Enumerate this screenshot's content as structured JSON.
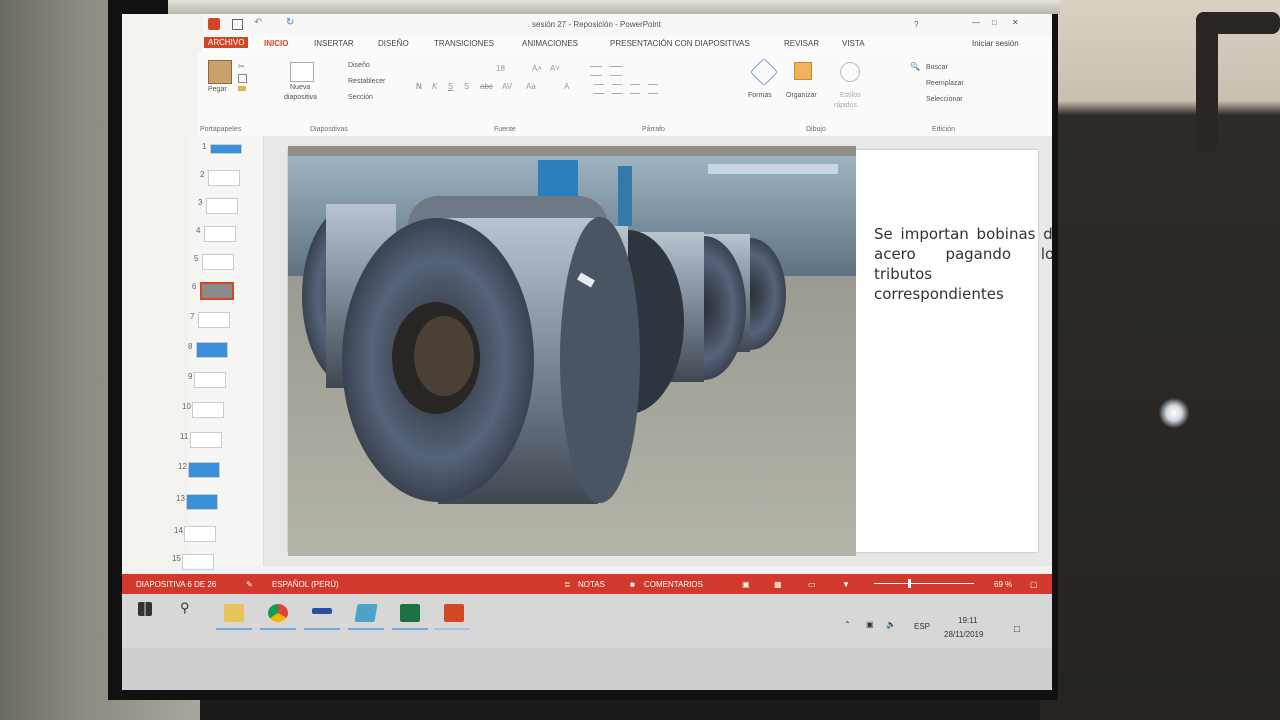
{
  "window": {
    "title": "sesión 27 - Reposición - PowerPoint",
    "help": "?",
    "signin": "Iniciar sesión"
  },
  "tabs": [
    "ARCHIVO",
    "INICIO",
    "INSERTAR",
    "DISEÑO",
    "TRANSICIONES",
    "ANIMACIONES",
    "PRESENTACIÓN CON DIAPOSITIVAS",
    "REVISAR",
    "VISTA"
  ],
  "ribbon": {
    "paste_label": "Pegar",
    "clipboard_group": "Portapapeles",
    "new_slide_line1": "Nueva",
    "new_slide_line2": "diapositiva",
    "layout": "Diseño",
    "reset": "Restablecer",
    "section": "Sección",
    "slides_group": "Diapositivas",
    "font_group": "Fuente",
    "paragraph_group": "Párrafo",
    "shapes": "Formas",
    "arrange": "Organizar",
    "quick_styles_line1": "Estilos",
    "quick_styles_line2": "rápidos",
    "drawing_group": "Dibujo",
    "find": "Buscar",
    "replace": "Reemplazar",
    "select": "Seleccionar",
    "editing_group": "Edición",
    "font_size": "18",
    "font_glyphs": [
      "A˄",
      "A˅",
      "N",
      "K",
      "S",
      "S",
      "abc",
      "AV",
      "Aa",
      "A"
    ]
  },
  "thumbnails": [
    "1",
    "2",
    "3",
    "4",
    "5",
    "6",
    "7",
    "8",
    "9",
    "10",
    "11",
    "12",
    "13",
    "14",
    "15"
  ],
  "slide": {
    "text": "Se importan bobinas de acero pagando los tributos correspondientes"
  },
  "status": {
    "slide_info": "DIAPOSITIVA 6 DE 26",
    "language": "ESPAÑOL (PERÚ)",
    "notes": "NOTAS",
    "comments": "COMENTARIOS",
    "zoom": "69 %"
  },
  "taskbar": {
    "tray_language": "ESP",
    "time": "19:11",
    "date": "28/11/2019"
  },
  "colors": {
    "accent": "#d24726",
    "status_bar": "#d0392b"
  }
}
